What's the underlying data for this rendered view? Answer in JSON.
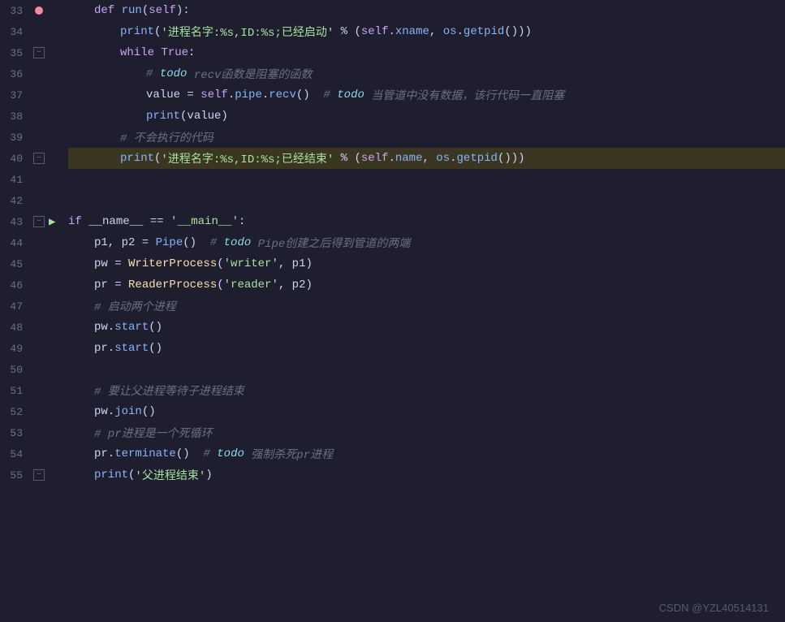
{
  "editor": {
    "background": "#1e1e2e",
    "watermark": "CSDN @YZL40514131"
  },
  "lines": [
    {
      "num": 33,
      "indent": 1,
      "has_breakpoint": true,
      "has_fold": false,
      "run_arrow": false,
      "highlighted": false,
      "content": "def_run"
    },
    {
      "num": 34,
      "indent": 2,
      "has_breakpoint": false,
      "has_fold": false,
      "run_arrow": false,
      "highlighted": false,
      "content": "print_start"
    },
    {
      "num": 35,
      "indent": 2,
      "has_breakpoint": false,
      "has_fold": true,
      "run_arrow": false,
      "highlighted": false,
      "content": "while_true"
    },
    {
      "num": 36,
      "indent": 3,
      "has_breakpoint": false,
      "has_fold": false,
      "run_arrow": false,
      "highlighted": false,
      "content": "comment_todo_recv"
    },
    {
      "num": 37,
      "indent": 3,
      "has_breakpoint": false,
      "has_fold": false,
      "run_arrow": false,
      "highlighted": false,
      "content": "value_recv"
    },
    {
      "num": 38,
      "indent": 3,
      "has_breakpoint": false,
      "has_fold": false,
      "run_arrow": false,
      "highlighted": false,
      "content": "print_value"
    },
    {
      "num": 39,
      "indent": 2,
      "has_breakpoint": false,
      "has_fold": false,
      "run_arrow": false,
      "highlighted": false,
      "content": "comment_not_run"
    },
    {
      "num": 40,
      "indent": 2,
      "has_breakpoint": false,
      "has_fold": false,
      "run_arrow": false,
      "highlighted": true,
      "content": "print_end"
    },
    {
      "num": 41,
      "indent": 0,
      "has_breakpoint": false,
      "has_fold": false,
      "run_arrow": false,
      "highlighted": false,
      "content": "empty"
    },
    {
      "num": 42,
      "indent": 0,
      "has_breakpoint": false,
      "has_fold": false,
      "run_arrow": false,
      "highlighted": false,
      "content": "empty"
    },
    {
      "num": 43,
      "indent": 0,
      "has_breakpoint": false,
      "has_fold": true,
      "run_arrow": true,
      "highlighted": false,
      "content": "if_main"
    },
    {
      "num": 44,
      "indent": 1,
      "has_breakpoint": false,
      "has_fold": false,
      "run_arrow": false,
      "highlighted": false,
      "content": "pipe_assign"
    },
    {
      "num": 45,
      "indent": 1,
      "has_breakpoint": false,
      "has_fold": false,
      "run_arrow": false,
      "highlighted": false,
      "content": "pw_assign"
    },
    {
      "num": 46,
      "indent": 1,
      "has_breakpoint": false,
      "has_fold": false,
      "run_arrow": false,
      "highlighted": false,
      "content": "pr_assign"
    },
    {
      "num": 47,
      "indent": 1,
      "has_breakpoint": false,
      "has_fold": false,
      "run_arrow": false,
      "highlighted": false,
      "content": "comment_start_proc"
    },
    {
      "num": 48,
      "indent": 1,
      "has_breakpoint": false,
      "has_fold": false,
      "run_arrow": false,
      "highlighted": false,
      "content": "pw_start"
    },
    {
      "num": 49,
      "indent": 1,
      "has_breakpoint": false,
      "has_fold": false,
      "run_arrow": false,
      "highlighted": false,
      "content": "pr_start"
    },
    {
      "num": 50,
      "indent": 0,
      "has_breakpoint": false,
      "has_fold": false,
      "run_arrow": false,
      "highlighted": false,
      "content": "empty"
    },
    {
      "num": 51,
      "indent": 1,
      "has_breakpoint": false,
      "has_fold": false,
      "run_arrow": false,
      "highlighted": false,
      "content": "comment_wait"
    },
    {
      "num": 52,
      "indent": 1,
      "has_breakpoint": false,
      "has_fold": false,
      "run_arrow": false,
      "highlighted": false,
      "content": "pw_join"
    },
    {
      "num": 53,
      "indent": 1,
      "has_breakpoint": false,
      "has_fold": false,
      "run_arrow": false,
      "highlighted": false,
      "content": "comment_dead_loop"
    },
    {
      "num": 54,
      "indent": 1,
      "has_breakpoint": false,
      "has_fold": false,
      "run_arrow": false,
      "highlighted": false,
      "content": "pr_terminate"
    },
    {
      "num": 55,
      "indent": 1,
      "has_breakpoint": false,
      "has_fold": true,
      "run_arrow": false,
      "highlighted": false,
      "content": "print_father_end"
    }
  ]
}
